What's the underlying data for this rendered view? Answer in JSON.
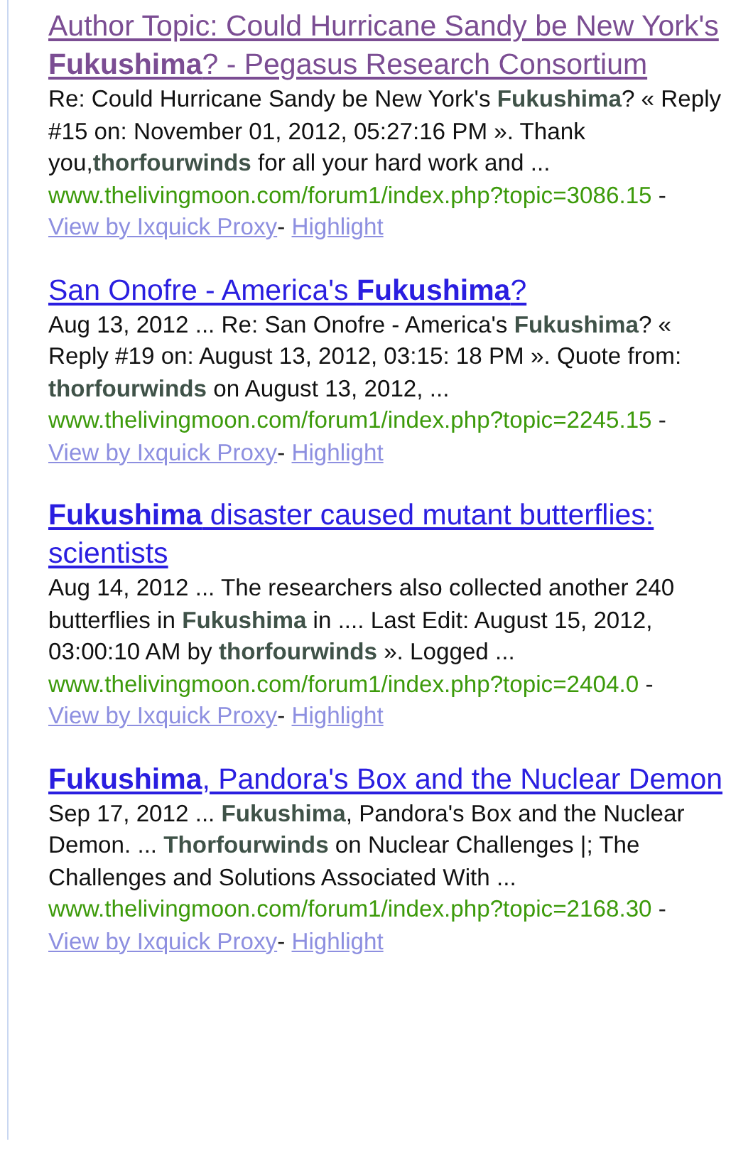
{
  "separator": "-",
  "results": [
    {
      "title": "Author Topic: Could Hurricane Sandy be New York's **Fukushima**? - Pegasus Research Consortium",
      "visited": true,
      "snippet": "Re: Could Hurricane Sandy be New York's **Fukushima**? « Reply #15 on: November 01, 2012, 05:27:16 PM ». Thank you,**thorfourwinds** for all your hard work and ...",
      "url": "www.thelivingmoon.com/forum1/index.php?topic=3086.15",
      "links": [
        "View by Ixquick Proxy",
        "Highlight"
      ]
    },
    {
      "title": "San Onofre - America's **Fukushima**?",
      "visited": false,
      "snippet": "Aug 13, 2012 ... Re: San Onofre - America's **Fukushima**? « Reply #19 on: August 13, 2012, 03:15: 18 PM ». Quote from: **thorfourwinds** on August 13, 2012, ...",
      "url": "www.thelivingmoon.com/forum1/index.php?topic=2245.15",
      "links": [
        "View by Ixquick Proxy",
        "Highlight"
      ]
    },
    {
      "title": "**Fukushima** disaster caused mutant butterflies: scientists",
      "visited": false,
      "snippet": "Aug 14, 2012 ... The researchers also collected another 240 butterflies in **Fukushima** in .... Last Edit: August 15, 2012, 03:00:10 AM by **thorfourwinds** ». Logged ...",
      "url": "www.thelivingmoon.com/forum1/index.php?topic=2404.0",
      "links": [
        "View by Ixquick Proxy",
        "Highlight"
      ]
    },
    {
      "title": "**Fukushima**, Pandora's Box and the Nuclear Demon",
      "visited": false,
      "snippet": "Sep 17, 2012 ... **Fukushima**, Pandora's Box and the Nuclear Demon. ... **Thorfourwinds** on Nuclear Challenges |; The Challenges and Solutions Associated With ...",
      "url": "www.thelivingmoon.com/forum1/index.php?topic=2168.30",
      "links": [
        "View by Ixquick Proxy",
        "Highlight"
      ]
    }
  ]
}
